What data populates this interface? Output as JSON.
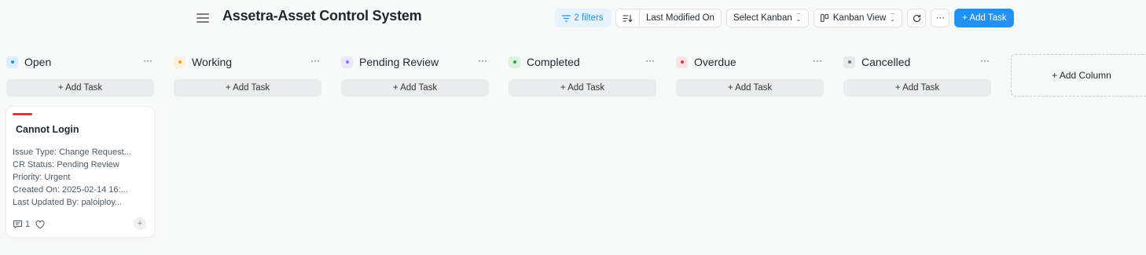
{
  "header": {
    "title": "Assetra-Asset Control System"
  },
  "toolbar": {
    "filters_label": "2 filters",
    "sort_label": "Last Modified On",
    "select_kanban_label": "Select Kanban",
    "view_label": "Kanban View",
    "more_label": "···",
    "add_task_label": "+ Add Task"
  },
  "columns": [
    {
      "title": "Open",
      "dot_color": "#2490ef",
      "dot_bg": "#dceefc",
      "add_label": "+ Add Task",
      "more": "···"
    },
    {
      "title": "Working",
      "dot_color": "#f59e0b",
      "dot_bg": "#fdf0dc",
      "add_label": "+ Add Task",
      "more": "···"
    },
    {
      "title": "Pending Review",
      "dot_color": "#8b7cf6",
      "dot_bg": "#ebe8fd",
      "add_label": "+ Add Task",
      "more": "···"
    },
    {
      "title": "Completed",
      "dot_color": "#28a745",
      "dot_bg": "#dcf3e2",
      "add_label": "+ Add Task",
      "more": "···"
    },
    {
      "title": "Overdue",
      "dot_color": "#e03636",
      "dot_bg": "#fde4e4",
      "add_label": "+ Add Task",
      "more": "···"
    },
    {
      "title": "Cancelled",
      "dot_color": "#6c757d",
      "dot_bg": "#e7e8ea",
      "add_label": "+ Add Task",
      "more": "···"
    }
  ],
  "add_column_label": "+ Add Column",
  "card": {
    "title": "Cannot Login",
    "accent": "#e03636",
    "fields": [
      "Issue Type: Change Request...",
      "CR Status: Pending Review",
      "Priority: Urgent",
      "Created On: 2025-02-14 16:...",
      "Last Updated By: paloiploy..."
    ],
    "comment_count": "1",
    "plus_label": "+"
  }
}
